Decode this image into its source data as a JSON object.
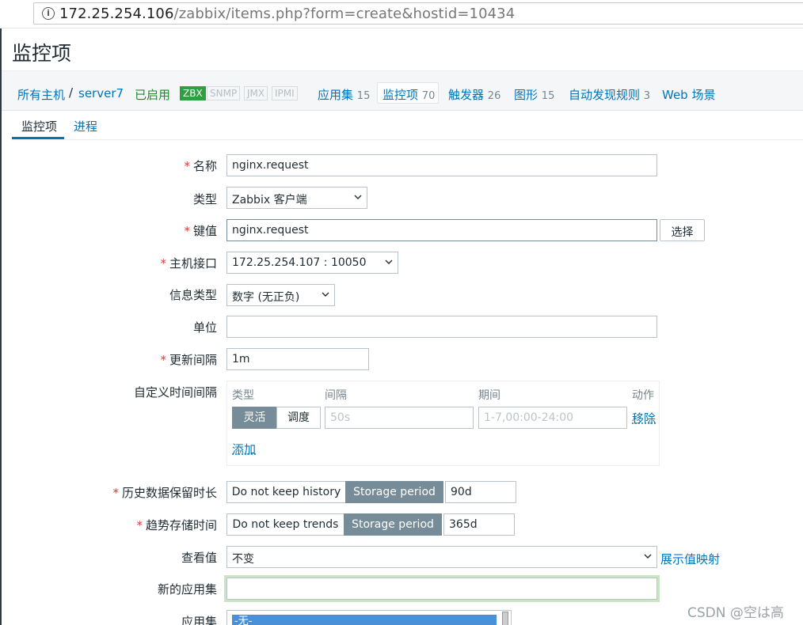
{
  "browser": {
    "url_host": "172.25.254.106",
    "url_path": "/zabbix/items.php?form=create&hostid=10434"
  },
  "page": {
    "title": "监控项"
  },
  "breadcrumb": {
    "all_hosts": "所有主机",
    "separator": "/",
    "host": "server7",
    "enabled": "已启用",
    "badges": [
      "ZBX",
      "SNMP",
      "JMX",
      "IPMI"
    ],
    "links": [
      {
        "label": "应用集",
        "count": "15"
      },
      {
        "label": "监控项",
        "count": "70"
      },
      {
        "label": "触发器",
        "count": "26"
      },
      {
        "label": "图形",
        "count": "15"
      },
      {
        "label": "自动发现规则",
        "count": "3"
      },
      {
        "label": "Web 场景",
        "count": ""
      }
    ]
  },
  "tabs": {
    "items": "监控项",
    "process": "进程"
  },
  "form": {
    "name": {
      "label": "名称",
      "value": "nginx.request"
    },
    "type": {
      "label": "类型",
      "value": "Zabbix 客户端"
    },
    "key": {
      "label": "键值",
      "value": "nginx.request",
      "select_button": "选择"
    },
    "interface": {
      "label": "主机接口",
      "value": "172.25.254.107 : 10050"
    },
    "info_type": {
      "label": "信息类型",
      "value": "数字 (无正负)"
    },
    "units": {
      "label": "单位",
      "value": ""
    },
    "update_interval": {
      "label": "更新间隔",
      "value": "1m"
    },
    "custom_intervals": {
      "label": "自定义时间间隔",
      "col_type": "类型",
      "col_interval": "间隔",
      "col_period": "期间",
      "col_action": "动作",
      "flexible": "灵活",
      "scheduling": "调度",
      "interval_placeholder": "50s",
      "period_placeholder": "1-7,00:00-24:00",
      "remove": "移除",
      "add": "添加"
    },
    "history": {
      "label": "历史数据保留时长",
      "no_keep": "Do not keep history",
      "storage": "Storage period",
      "value": "90d"
    },
    "trends": {
      "label": "趋势存储时间",
      "no_keep": "Do not keep trends",
      "storage": "Storage period",
      "value": "365d"
    },
    "valuemap": {
      "label": "查看值",
      "value": "不变",
      "link": "展示值映射"
    },
    "new_application": {
      "label": "新的应用集",
      "value": ""
    },
    "applications": {
      "label": "应用集",
      "selected": "-无-"
    }
  },
  "watermark": "CSDN @空は高"
}
